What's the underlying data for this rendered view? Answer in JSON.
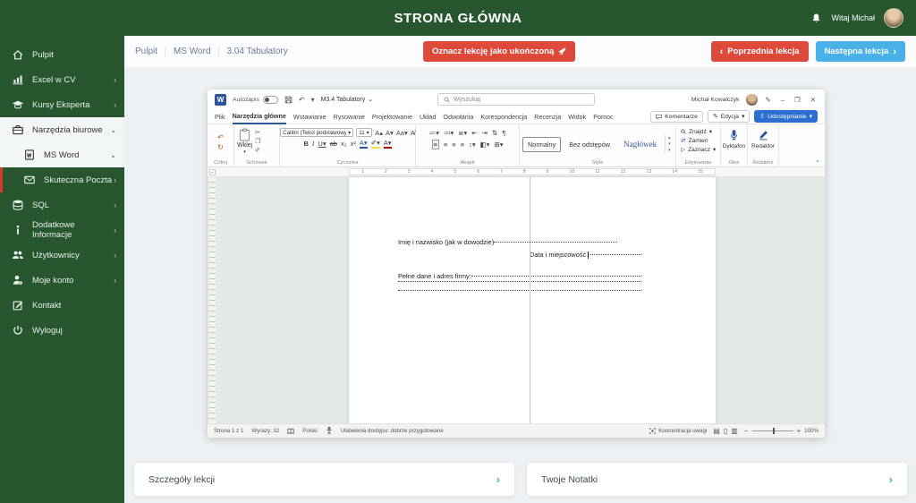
{
  "colors": {
    "brand_green": "#27562f",
    "accent_red": "#dd4a3c",
    "accent_blue": "#4ab1e8",
    "word_blue": "#2b579a",
    "share_blue": "#2d6fd0"
  },
  "header": {
    "title": "STRONA GŁÓWNA",
    "greeting": "Witaj Michał"
  },
  "sidebar": {
    "items": [
      {
        "label": "Pulpit"
      },
      {
        "label": "Excel w CV"
      },
      {
        "label": "Kursy Eksperta"
      },
      {
        "label": "Narzędzia biurowe"
      },
      {
        "label": "MS Word"
      },
      {
        "label": "Skuteczna Poczta"
      },
      {
        "label": "SQL"
      },
      {
        "label": "Dodatkowe Informacje"
      },
      {
        "label": "Użytkownicy"
      },
      {
        "label": "Moje konto"
      },
      {
        "label": "Kontakt"
      },
      {
        "label": "Wyloguj"
      }
    ]
  },
  "toolbar": {
    "breadcrumb": [
      "Pulpit",
      "MS Word",
      "3.04 Tabulatory"
    ],
    "complete_label": "Oznacz lekcję jako ukończoną",
    "prev_label": "Poprzednia lekcja",
    "next_label": "Następna lekcja"
  },
  "word": {
    "titlebar": {
      "autosave": "Autozapis",
      "docname": "M3.4 Tabulatory",
      "search_placeholder": "Wyszukaj",
      "user": "Michał Kowalczyk"
    },
    "tabs": [
      "Plik",
      "Narzędzia główne",
      "Wstawianie",
      "Rysowanie",
      "Projektowanie",
      "Układ",
      "Odwołania",
      "Korespondencja",
      "Recenzja",
      "Widok",
      "Pomoc"
    ],
    "top_buttons": {
      "comments": "Komentarze",
      "editing": "Edycja",
      "share": "Udostępnianie"
    },
    "ribbon": {
      "undo_group": "Cofnij",
      "clipboard_group": "Schowek",
      "paste": "Wklej",
      "font_group": "Czcionka",
      "font_name": "Calibri (Tekst podstawowy)",
      "font_size": "11",
      "paragraph_group": "Akapit",
      "styles_group": "Style",
      "styles": [
        "Normalny",
        "Bez odstępów",
        "Nagłówek"
      ],
      "editing_group": "Edytowanie",
      "find": "Znajdź",
      "replace": "Zamień",
      "select": "Zaznacz",
      "voice_group": "Głos",
      "dictate": "Dyktafon",
      "editor_group": "Redaktor",
      "editor": "Redaktor"
    },
    "ruler_numbers": [
      "1",
      "2",
      "3",
      "4",
      "5",
      "6",
      "7",
      "8",
      "9",
      "10",
      "11",
      "12",
      "13",
      "14",
      "15"
    ],
    "document": {
      "line1": "Imię i nazwisko (jak w dowodzie)",
      "line2": "Data i miejscowość",
      "line3": "Pełne dane i adres firmy:"
    },
    "statusbar": {
      "page": "Strona 1 z 1",
      "words": "Wyrazy: 32",
      "language": "Polski",
      "accessibility": "Ułatwienia dostępu: dobrze przygotowane",
      "focus": "Koncentracja uwagi",
      "zoom": "100%"
    }
  },
  "cards": [
    {
      "label": "Szczegóły lekcji"
    },
    {
      "label": "Twoje Notatki"
    }
  ]
}
